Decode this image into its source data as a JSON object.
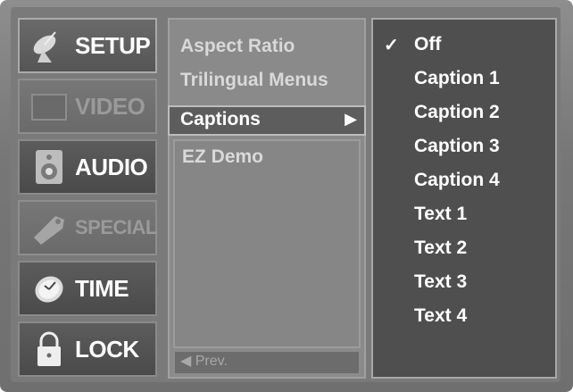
{
  "tabs": [
    {
      "label": "SETUP",
      "icon": "satellite-dish-icon",
      "state": "active"
    },
    {
      "label": "VIDEO",
      "icon": "tv-screen-icon",
      "state": "dim"
    },
    {
      "label": "AUDIO",
      "icon": "speaker-icon",
      "state": "normal"
    },
    {
      "label": "SPECIAL",
      "icon": "tag-icon",
      "state": "dim"
    },
    {
      "label": "TIME",
      "icon": "clock-icon",
      "state": "normal"
    },
    {
      "label": "LOCK",
      "icon": "padlock-icon",
      "state": "normal"
    }
  ],
  "menu": {
    "items": [
      "Aspect Ratio",
      "Trilingual Menus"
    ],
    "selected": "Captions",
    "selected_arrow": "▶",
    "more": [
      "EZ Demo"
    ],
    "prev": "◀ Prev."
  },
  "submenu": {
    "check": "✓",
    "options": [
      "Off",
      "Caption 1",
      "Caption 2",
      "Caption 3",
      "Caption 4",
      "Text 1",
      "Text 2",
      "Text 3",
      "Text 4"
    ]
  }
}
